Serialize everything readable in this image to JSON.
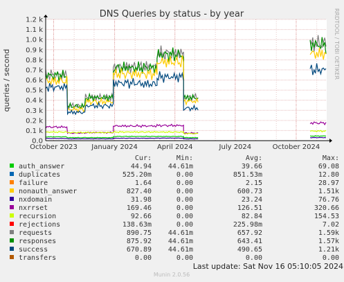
{
  "chart_data": {
    "type": "line",
    "title": "DNS Queries by status - by year",
    "ylabel": "queries / second",
    "side_label": "RRDTOOL / TOBI OETIKER",
    "ylim": [
      0,
      1200
    ],
    "y_ticks": [
      "0.0",
      "0.1 k",
      "0.2 k",
      "0.3 k",
      "0.4 k",
      "0.5 k",
      "0.6 k",
      "0.7 k",
      "0.8 k",
      "0.9 k",
      "1.0 k",
      "1.1 k",
      "1.2 k"
    ],
    "y_tick_values": [
      0,
      100,
      200,
      300,
      400,
      500,
      600,
      700,
      800,
      900,
      1000,
      1100,
      1200
    ],
    "x_ticks": [
      "October 2023",
      "January 2024",
      "April 2024",
      "July 2024",
      "October 2024"
    ],
    "x_tick_dates": [
      "2023-10-01",
      "2024-01-01",
      "2024-04-01",
      "2024-07-01",
      "2024-10-01"
    ],
    "x_range": [
      "2023-09-19",
      "2024-11-16"
    ],
    "grid": true,
    "legend_columns": [
      "Cur:",
      "Min:",
      "Avg:",
      "Max:"
    ],
    "series": [
      {
        "name": "auth_answer",
        "color": "#00cc00",
        "values": [
          "44.94",
          "44.61m",
          "39.66",
          "69.08"
        ]
      },
      {
        "name": "duplicates",
        "color": "#0066b3",
        "values": [
          "525.20m",
          "0.00",
          "851.53m",
          "12.80"
        ]
      },
      {
        "name": "failure",
        "color": "#ff8000",
        "values": [
          "1.64",
          "0.00",
          "2.15",
          "28.97"
        ]
      },
      {
        "name": "nonauth_answer",
        "color": "#ffcc00",
        "values": [
          "827.40",
          "0.00",
          "600.73",
          "1.51k"
        ]
      },
      {
        "name": "nxdomain",
        "color": "#330099",
        "values": [
          "31.98",
          "0.00",
          "23.24",
          "76.76"
        ]
      },
      {
        "name": "nxrrset",
        "color": "#990099",
        "values": [
          "169.46",
          "0.00",
          "126.51",
          "320.66"
        ]
      },
      {
        "name": "recursion",
        "color": "#ccff00",
        "values": [
          "92.66",
          "0.00",
          "82.84",
          "154.53"
        ]
      },
      {
        "name": "rejections",
        "color": "#ff0000",
        "values": [
          "138.63m",
          "0.00",
          "225.98m",
          "7.02"
        ]
      },
      {
        "name": "requests",
        "color": "#808080",
        "values": [
          "890.75",
          "44.61m",
          "657.92",
          "1.59k"
        ]
      },
      {
        "name": "responses",
        "color": "#008f00",
        "values": [
          "875.92",
          "44.61m",
          "643.41",
          "1.57k"
        ]
      },
      {
        "name": "success",
        "color": "#00487d",
        "values": [
          "670.89",
          "44.61m",
          "490.65",
          "1.21k"
        ]
      },
      {
        "name": "transfers",
        "color": "#b35a00",
        "values": [
          "0.00",
          "0.00",
          "0.00",
          "0.00"
        ]
      }
    ],
    "plot_series": [
      {
        "name": "requests",
        "color": "#808080",
        "periods": [
          [
            "2023-09-19",
            "2023-10-22",
            650
          ],
          [
            "2023-10-22",
            "2023-11-18",
            345
          ],
          [
            "2023-11-18",
            "2023-12-30",
            430
          ],
          [
            "2023-12-30",
            "2024-02-08",
            730
          ],
          [
            "2024-02-08",
            "2024-03-05",
            730
          ],
          [
            "2024-03-05",
            "2024-04-14",
            860
          ],
          [
            "2024-04-14",
            "2024-05-06",
            430
          ],
          [
            "2024-10-22",
            "2024-11-16",
            960
          ]
        ]
      },
      {
        "name": "responses",
        "color": "#008f00",
        "periods": [
          [
            "2023-09-19",
            "2023-10-22",
            645
          ],
          [
            "2023-10-22",
            "2023-11-18",
            340
          ],
          [
            "2023-11-18",
            "2023-12-30",
            425
          ],
          [
            "2023-12-30",
            "2024-02-08",
            720
          ],
          [
            "2024-02-08",
            "2024-03-05",
            720
          ],
          [
            "2024-03-05",
            "2024-04-14",
            850
          ],
          [
            "2024-04-14",
            "2024-05-06",
            425
          ],
          [
            "2024-10-22",
            "2024-11-16",
            950
          ]
        ]
      },
      {
        "name": "nonauth_answer",
        "color": "#ffcc00",
        "periods": [
          [
            "2023-09-19",
            "2023-10-22",
            590
          ],
          [
            "2023-10-22",
            "2023-11-18",
            310
          ],
          [
            "2023-11-18",
            "2023-12-30",
            385
          ],
          [
            "2023-12-30",
            "2024-02-08",
            660
          ],
          [
            "2024-02-08",
            "2024-03-05",
            660
          ],
          [
            "2024-03-05",
            "2024-04-14",
            780
          ],
          [
            "2024-04-14",
            "2024-05-06",
            390
          ],
          [
            "2024-10-22",
            "2024-11-16",
            860
          ]
        ]
      },
      {
        "name": "success",
        "color": "#00487d",
        "periods": [
          [
            "2023-09-19",
            "2023-10-22",
            530
          ],
          [
            "2023-10-22",
            "2023-11-18",
            280
          ],
          [
            "2023-11-18",
            "2023-12-30",
            345
          ],
          [
            "2023-12-30",
            "2024-02-08",
            570
          ],
          [
            "2024-02-08",
            "2024-03-05",
            560
          ],
          [
            "2024-03-05",
            "2024-04-14",
            630
          ],
          [
            "2024-04-14",
            "2024-05-06",
            320
          ],
          [
            "2024-10-22",
            "2024-11-16",
            700
          ]
        ]
      },
      {
        "name": "nxrrset",
        "color": "#990099",
        "periods": [
          [
            "2023-09-19",
            "2023-10-22",
            135
          ],
          [
            "2023-10-22",
            "2023-11-18",
            75
          ],
          [
            "2023-11-18",
            "2023-12-30",
            80
          ],
          [
            "2023-12-30",
            "2024-02-08",
            145
          ],
          [
            "2024-02-08",
            "2024-03-05",
            145
          ],
          [
            "2024-03-05",
            "2024-04-14",
            150
          ],
          [
            "2024-04-14",
            "2024-05-06",
            75
          ],
          [
            "2024-10-22",
            "2024-11-16",
            175
          ]
        ]
      },
      {
        "name": "recursion",
        "color": "#ccff00",
        "periods": [
          [
            "2023-09-19",
            "2023-10-22",
            85
          ],
          [
            "2023-10-22",
            "2023-11-18",
            80
          ],
          [
            "2023-11-18",
            "2023-12-30",
            80
          ],
          [
            "2023-12-30",
            "2024-02-08",
            85
          ],
          [
            "2024-02-08",
            "2024-03-05",
            85
          ],
          [
            "2024-03-05",
            "2024-04-14",
            85
          ],
          [
            "2024-04-14",
            "2024-05-06",
            70
          ],
          [
            "2024-10-22",
            "2024-11-16",
            95
          ]
        ]
      },
      {
        "name": "auth_answer",
        "color": "#00cc00",
        "periods": [
          [
            "2023-09-19",
            "2023-10-22",
            38
          ],
          [
            "2023-10-22",
            "2023-11-18",
            30
          ],
          [
            "2023-11-18",
            "2023-12-30",
            30
          ],
          [
            "2023-12-30",
            "2024-02-08",
            42
          ],
          [
            "2024-02-08",
            "2024-03-05",
            42
          ],
          [
            "2024-03-05",
            "2024-04-14",
            42
          ],
          [
            "2024-04-14",
            "2024-05-06",
            30
          ],
          [
            "2024-10-22",
            "2024-11-16",
            46
          ]
        ]
      },
      {
        "name": "nxdomain",
        "color": "#330099",
        "periods": [
          [
            "2023-09-19",
            "2023-10-22",
            22
          ],
          [
            "2023-10-22",
            "2023-11-18",
            18
          ],
          [
            "2023-11-18",
            "2023-12-30",
            18
          ],
          [
            "2023-12-30",
            "2024-02-08",
            24
          ],
          [
            "2024-02-08",
            "2024-03-05",
            24
          ],
          [
            "2024-03-05",
            "2024-04-14",
            25
          ],
          [
            "2024-04-14",
            "2024-05-06",
            18
          ],
          [
            "2024-10-22",
            "2024-11-16",
            30
          ]
        ]
      }
    ],
    "footer_text": "Last update: Sat Nov 16 05:10:05 2024",
    "version": "Munin 2.0.56"
  }
}
